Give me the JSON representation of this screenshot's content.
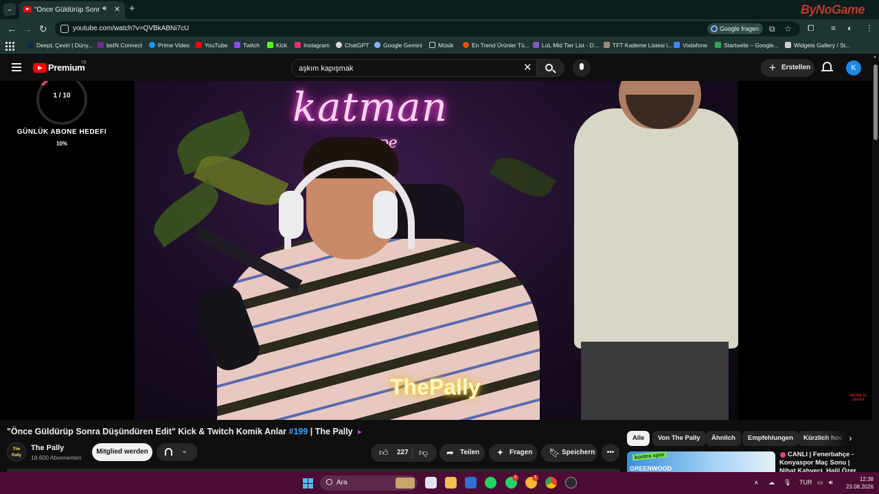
{
  "browser": {
    "tab_title": "\"Önce Güldürüp Sonra Düşündüren Edit\" Kick & Twitch Komik Anlar #199 | The Pally",
    "url": "youtube.com/watch?v=QVBkABNi7cU",
    "google_ask_label": "Google fragen",
    "brand": "ByNoGame",
    "bookmarks": [
      "DeepL Çeviri | Düny...",
      "beIN Connect",
      "Prime Video",
      "YouTube",
      "Twitch",
      "Kick",
      "Instagram",
      "ChatGPT",
      "Google Gemini",
      "Müsik",
      "En Trend Ürünler Tü...",
      "LoL Mid Tier List - D...",
      "TFT Kademe Listesi i...",
      "Vodafone",
      "Startseite – Google...",
      "Widgets Gallery / St..."
    ]
  },
  "youtube": {
    "logo_text": "Premium",
    "region": "TR",
    "search_value": "aşkım kapışmak",
    "create_label": "Erstellen",
    "avatar_letter": "K"
  },
  "overlay": {
    "goal_count": "1 / 10",
    "goal_title": "GÜNLÜK ABONE HEDEFI",
    "goal_percent": "10%",
    "goal_fraction": 0.1,
    "caption": "ThePally",
    "neon_text": "katman",
    "neon_sub": "cope",
    "watermark": "ABONE OL SANKA"
  },
  "video": {
    "title_main": "\"Önce Güldürüp Sonra Düşündüren Edit\" Kick & Twitch Komik Anlar ",
    "title_hashtag": "#199",
    "title_tail": " | The Pally",
    "channel_name": "The Pally",
    "channel_avatar_text": "The Pally",
    "subscribers": "18.600 Abonnenten",
    "join_label": "Mitglied werden",
    "like_count": "227",
    "share_label": "Teilen",
    "ask_label": "Fragen",
    "save_label": "Speichern"
  },
  "chips": [
    "Alle",
    "Von The Pally",
    "Ähnlich",
    "Empfehlungen",
    "Kürzlich hoc"
  ],
  "recommendation": {
    "thumb_label": "kontra spor",
    "thumb_sub": "GREENWOOD",
    "title": "CANLI | Fenerbahçe - Konyaspor Maç Sonu | Nihat Kahveci, Halil Özer"
  },
  "taskbar": {
    "search_placeholder": "Ara",
    "language": "TUR",
    "time": "12:38",
    "date": "23.08.2026",
    "badge_whatsapp": "1",
    "badge_app": "1"
  },
  "colors": {
    "youtube_red": "#ff0000",
    "link_blue": "#3ea6ff",
    "taskbar": "#4b0d33",
    "chrome_frame": "#1f3532"
  }
}
